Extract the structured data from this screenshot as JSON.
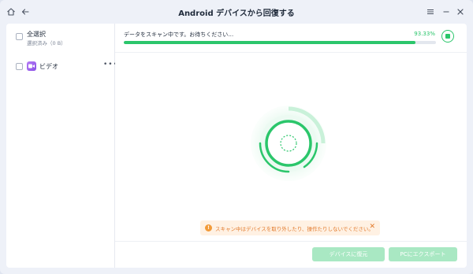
{
  "app": {
    "title": "Android デバイスから回復する"
  },
  "icons": {
    "home": "home-icon",
    "back": "arrow-left-icon",
    "menu": "menu-icon",
    "minimize": "minimize-icon",
    "close": "close-icon",
    "video": "video-camera-icon",
    "more": "more-dots-icon",
    "stop": "stop-icon",
    "warning": "warning-icon"
  },
  "sidebar": {
    "select_all": {
      "label": "全選択",
      "sub": "選択済み（0 B）"
    },
    "items": [
      {
        "label": "ビデオ"
      }
    ]
  },
  "scan": {
    "status_text": "データをスキャン中です。お待ちください…",
    "percent_text": "93.33%",
    "progress": 0.9333
  },
  "warning": {
    "text": "スキャン中はデバイスを取り外したり、操作たりしないでください。",
    "close": "✕"
  },
  "buttons": {
    "restore": "デバイスに復元",
    "export": "PCにエクスポート"
  },
  "colors": {
    "accent": "#2bc66b",
    "warning": "#f29a38",
    "button_disabled": "#a9e8c3"
  }
}
